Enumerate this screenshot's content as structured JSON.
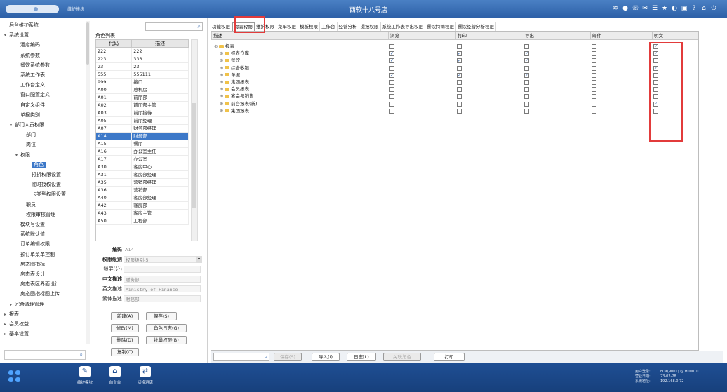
{
  "header": {
    "module_label": "维护模块",
    "title": "西软十八号店",
    "icons": [
      "wifi-icon",
      "record-icon",
      "phone-icon",
      "chat-icon",
      "list-icon",
      "star-icon",
      "settings-icon",
      "mail-icon",
      "help-icon",
      "home-icon",
      "power-icon"
    ]
  },
  "sidebar": {
    "items": [
      {
        "label": "后台维护系统",
        "level": 0,
        "arrow": ""
      },
      {
        "label": "系统设置",
        "level": 0,
        "arrow": "▾"
      },
      {
        "label": "酒店编码",
        "level": 2,
        "arrow": ""
      },
      {
        "label": "系统参数",
        "level": 2,
        "arrow": ""
      },
      {
        "label": "餐饮系统参数",
        "level": 2,
        "arrow": ""
      },
      {
        "label": "系统工作表",
        "level": 2,
        "arrow": ""
      },
      {
        "label": "工作台定义",
        "level": 2,
        "arrow": ""
      },
      {
        "label": "窗口配置定义",
        "level": 2,
        "arrow": ""
      },
      {
        "label": "自定义组件",
        "level": 2,
        "arrow": ""
      },
      {
        "label": "单据类别",
        "level": 2,
        "arrow": ""
      },
      {
        "label": "部门人员权限",
        "level": 1,
        "arrow": "▾"
      },
      {
        "label": "部门",
        "level": 3,
        "arrow": ""
      },
      {
        "label": "岗位",
        "level": 3,
        "arrow": ""
      },
      {
        "label": "权限",
        "level": 2,
        "arrow": "▾"
      },
      {
        "label": "角色",
        "level": 4,
        "arrow": "",
        "selected": true
      },
      {
        "label": "打折权限设置",
        "level": 4,
        "arrow": ""
      },
      {
        "label": "临时授权设置",
        "level": 4,
        "arrow": ""
      },
      {
        "label": "卡类型权限设置",
        "level": 4,
        "arrow": ""
      },
      {
        "label": "职员",
        "level": 3,
        "arrow": ""
      },
      {
        "label": "权限审核管理",
        "level": 3,
        "arrow": ""
      },
      {
        "label": "模块号设置",
        "level": 2,
        "arrow": ""
      },
      {
        "label": "系统默认值",
        "level": 2,
        "arrow": ""
      },
      {
        "label": "订单编辑权限",
        "level": 2,
        "arrow": ""
      },
      {
        "label": "预订单菜单控制",
        "level": 2,
        "arrow": ""
      },
      {
        "label": "房态图指标",
        "level": 2,
        "arrow": ""
      },
      {
        "label": "房态表设计",
        "level": 2,
        "arrow": ""
      },
      {
        "label": "房态表区界面设计",
        "level": 2,
        "arrow": ""
      },
      {
        "label": "房态图指标图上传",
        "level": 2,
        "arrow": ""
      },
      {
        "label": "冗余清理管理",
        "level": 1,
        "arrow": "▸"
      },
      {
        "label": "报表",
        "level": 0,
        "arrow": "▸"
      },
      {
        "label": "会员权益",
        "level": 0,
        "arrow": "▸"
      },
      {
        "label": "基本设置",
        "level": 0,
        "arrow": "▸"
      }
    ]
  },
  "roles": {
    "title": "角色列表",
    "col_code": "代码",
    "col_desc": "描述",
    "rows": [
      {
        "code": "222",
        "desc": "222"
      },
      {
        "code": "223",
        "desc": "333"
      },
      {
        "code": "23",
        "desc": "23"
      },
      {
        "code": "555",
        "desc": "555111"
      },
      {
        "code": "999",
        "desc": "接口"
      },
      {
        "code": "A00",
        "desc": "总机房"
      },
      {
        "code": "A01",
        "desc": "前厅部"
      },
      {
        "code": "A02",
        "desc": "前厅部主管"
      },
      {
        "code": "A03",
        "desc": "前厅接待"
      },
      {
        "code": "A05",
        "desc": "前厅经理"
      },
      {
        "code": "A07",
        "desc": "财务部经理"
      },
      {
        "code": "A14",
        "desc": "财务部",
        "selected": true
      },
      {
        "code": "A15",
        "desc": "餐厅"
      },
      {
        "code": "A16",
        "desc": "办公室主任"
      },
      {
        "code": "A17",
        "desc": "办公室"
      },
      {
        "code": "A30",
        "desc": "客房中心"
      },
      {
        "code": "A31",
        "desc": "客房部经理"
      },
      {
        "code": "A35",
        "desc": "营销部经理"
      },
      {
        "code": "A36",
        "desc": "营销部"
      },
      {
        "code": "A40",
        "desc": "客房部经理"
      },
      {
        "code": "A42",
        "desc": "客房部"
      },
      {
        "code": "A43",
        "desc": "客房主管"
      },
      {
        "code": "A50",
        "desc": "工程部"
      }
    ]
  },
  "form": {
    "code_label": "编码",
    "code_value": "A14",
    "level_label": "权限级别",
    "level_value": "权限级别-5",
    "lock_label": "锁屏(分)",
    "lock_value": "",
    "cn_label": "中文描述",
    "cn_value": "财务部",
    "en_label": "英文描述",
    "en_value": "Ministry of Finance",
    "full_label": "繁体描述",
    "full_value": "財務部"
  },
  "role_buttons": {
    "new": "新建(A)",
    "save": "保存(S)",
    "edit": "修改(M)",
    "log": "角色日志(G)",
    "delete": "删除(D)",
    "batch": "批量权限(B)",
    "copy": "复制(C)"
  },
  "tabs": [
    "功能权限",
    "报表权限",
    "维护权限",
    "菜单权限",
    "模板权限",
    "工作台",
    "经营分析",
    "提报权限",
    "系统工作表导出权限",
    "餐饮特殊权限",
    "餐饮经营分析权限"
  ],
  "grid": {
    "columns": [
      "描述",
      "浏览",
      "打印",
      "导出",
      "邮件",
      "明文"
    ],
    "rows": [
      {
        "name": "报表",
        "root": true,
        "checks": [
          false,
          false,
          false,
          false,
          true
        ]
      },
      {
        "name": "报表仓库",
        "checks": [
          true,
          true,
          true,
          false,
          true
        ]
      },
      {
        "name": "餐饮",
        "checks": [
          true,
          true,
          true,
          false,
          false
        ]
      },
      {
        "name": "综合收银",
        "checks": [
          false,
          false,
          false,
          false,
          true
        ]
      },
      {
        "name": "单据",
        "checks": [
          true,
          true,
          true,
          false,
          false
        ]
      },
      {
        "name": "集团报表",
        "checks": [
          false,
          false,
          false,
          false,
          false
        ]
      },
      {
        "name": "会员报表",
        "checks": [
          false,
          false,
          false,
          false,
          false
        ]
      },
      {
        "name": "宴会与销售",
        "checks": [
          false,
          false,
          false,
          false,
          false
        ]
      },
      {
        "name": "前台报表(新)",
        "checks": [
          false,
          false,
          false,
          false,
          true
        ]
      },
      {
        "name": "集团报表",
        "checks": [
          false,
          false,
          false,
          false,
          false
        ]
      }
    ]
  },
  "bottom": {
    "save": "保存(S)",
    "import": "导入(I)",
    "log": "日志(L)",
    "link_role": "关联角色",
    "print": "打印"
  },
  "taskbar": {
    "apps": [
      {
        "label": "维护模块",
        "icon": "wrench-icon",
        "glyph": "✎"
      },
      {
        "label": "前台台",
        "icon": "home-icon",
        "glyph": "⌂"
      },
      {
        "label": "切换酒店",
        "icon": "switch-icon",
        "glyph": "⇄"
      }
    ],
    "info": [
      {
        "k": "用户登录:",
        "v": "FOX(9001) @ H00010"
      },
      {
        "k": "营业日期:",
        "v": "23-02-28"
      },
      {
        "k": "系统地址:",
        "v": "192.168.0.72"
      }
    ]
  }
}
